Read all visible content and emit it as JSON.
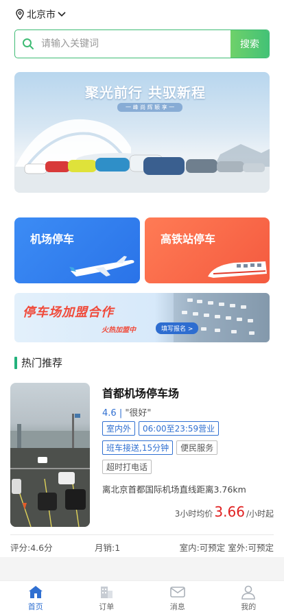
{
  "location": {
    "city": "北京市"
  },
  "search": {
    "placeholder": "请输入关键词",
    "button": "搜索"
  },
  "banner": {
    "headline": "聚光前行 共驭新程",
    "subline": "一 峰 尚 辉 颖 享 一"
  },
  "services": [
    {
      "label": "机场停车",
      "color": "#2f7ef0"
    },
    {
      "label": "高铁站停车",
      "color": "#f5684a"
    }
  ],
  "join_banner": {
    "title": "停车场加盟合作",
    "slogan": "火热加盟中",
    "button": "填写报名 >"
  },
  "section": {
    "title": "热门推荐"
  },
  "lot": {
    "name": "首都机场停车场",
    "rating": "4.6",
    "sep": "|",
    "comment": "\"很好\"",
    "tags_blue": [
      "室内外",
      "06:00至23:59营业",
      "班车接送,15分钟"
    ],
    "tags_gray": [
      "便民服务",
      "超时打电话"
    ],
    "distance": "离北京首都国际机场直线距离3.76km",
    "price_prefix": "3小时均价",
    "price": "3.66",
    "price_suffix": "/小时起",
    "score": "评分:4.6分",
    "sales": "月销:1",
    "availability": "室内:可预定 室外:可预定"
  },
  "tabbar": [
    {
      "label": "首页",
      "icon": "home-icon",
      "active": true
    },
    {
      "label": "订单",
      "icon": "building-icon",
      "active": false
    },
    {
      "label": "消息",
      "icon": "mail-icon",
      "active": false
    },
    {
      "label": "我的",
      "icon": "user-icon",
      "active": false
    }
  ],
  "colors": {
    "accent_green": "#3dbb73",
    "accent_blue": "#2f6fd1",
    "price_red": "#e02020"
  }
}
